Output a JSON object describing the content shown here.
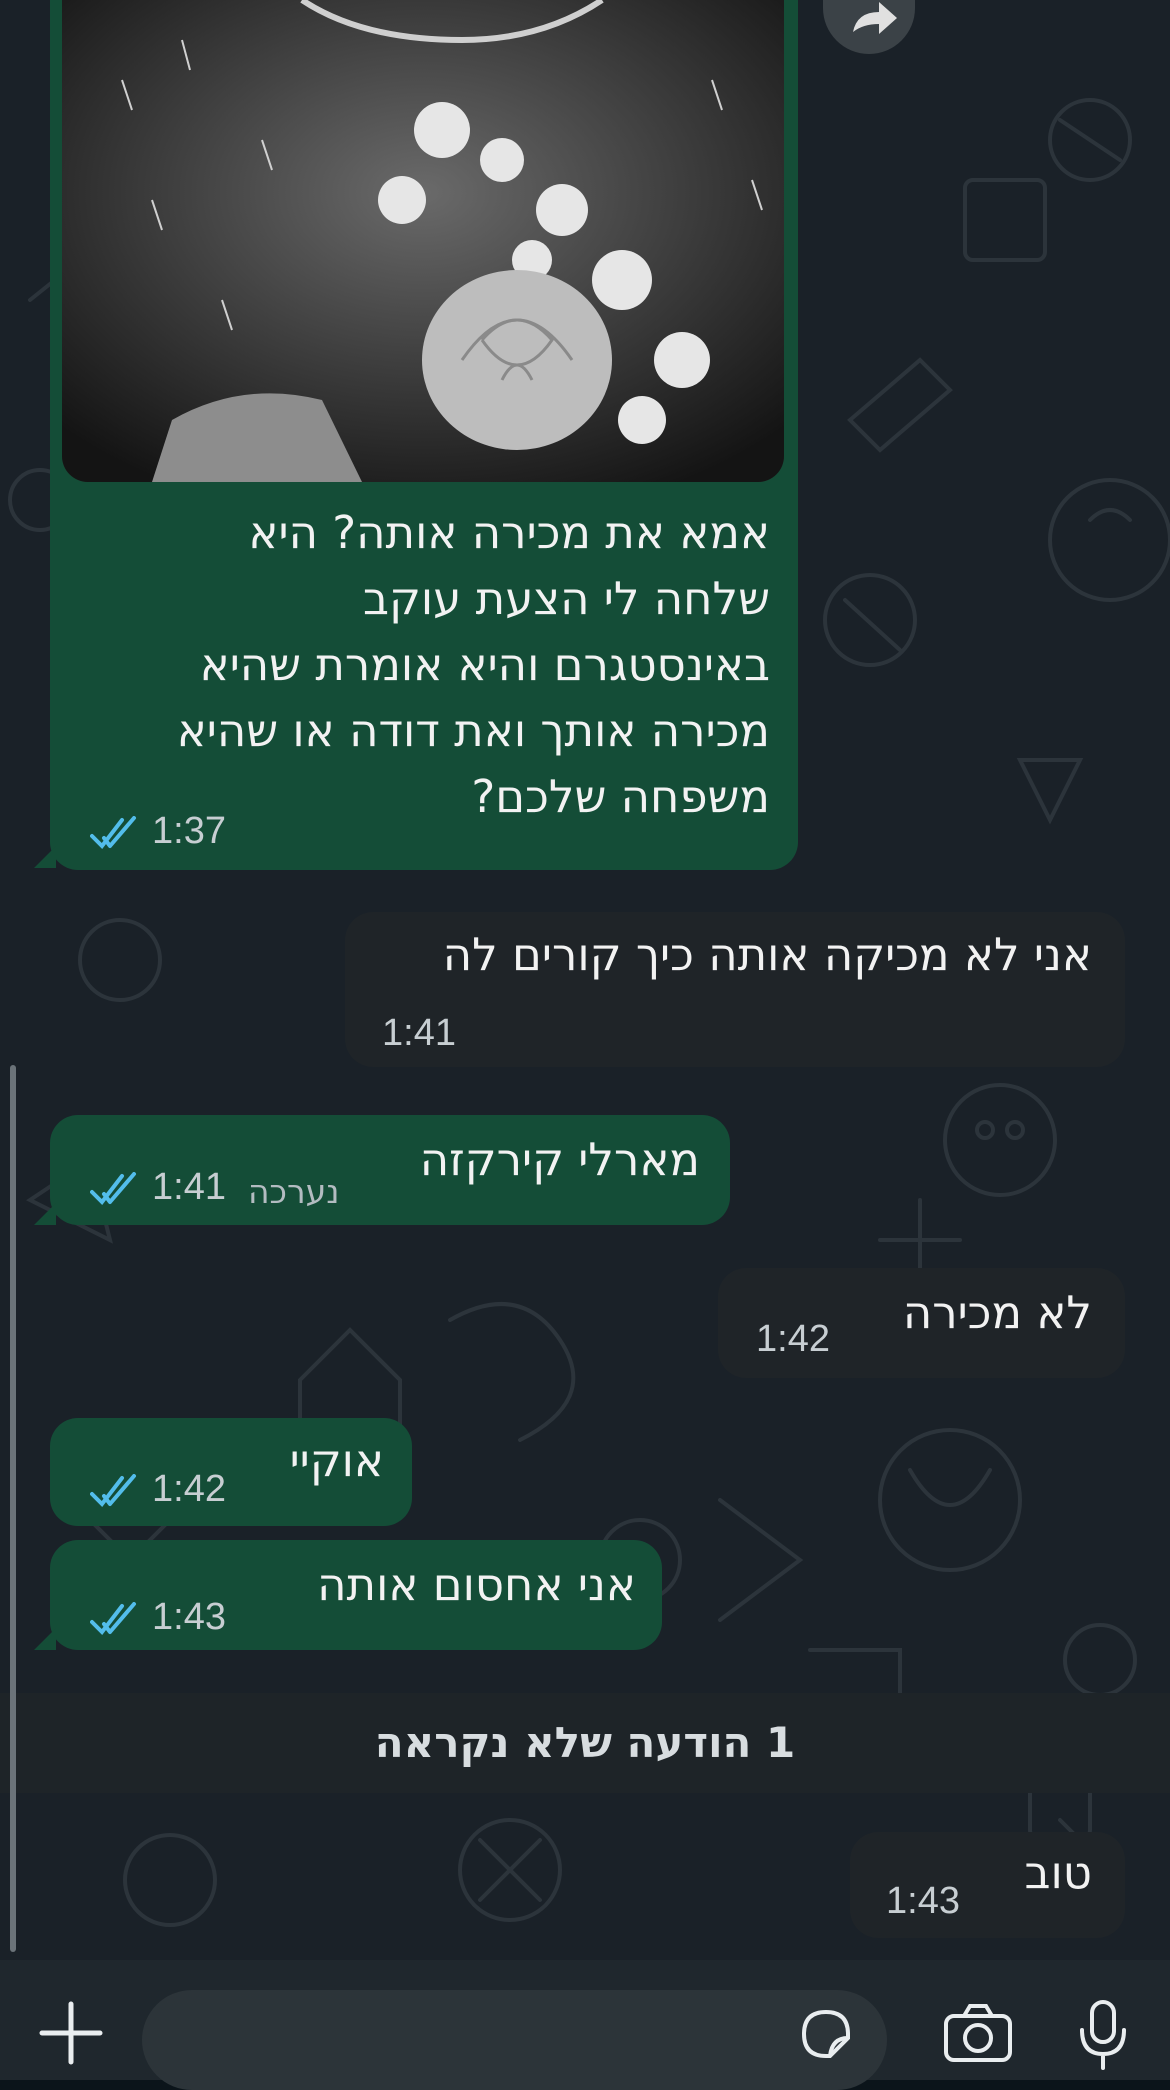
{
  "messages": [
    {
      "id": "m1",
      "direction": "out",
      "text": "אמא את מכירה אותה? היא\nשלחה לי הצעת עוקב\nבאינסטגרם והיא אומרת שהיא\nמכירה אותך ואת דודה או שהיא\nמשפחה שלכם?",
      "time": "1:37",
      "status": "read"
    },
    {
      "id": "m2",
      "direction": "in",
      "text": "אני לא מכיקה אותה כיך קורים לה",
      "time": "1:41"
    },
    {
      "id": "m3",
      "direction": "out",
      "text": "מארלי קירקזה",
      "time": "1:41",
      "edited": "נערכה",
      "status": "read"
    },
    {
      "id": "m4",
      "direction": "in",
      "text": "לא מכירה",
      "time": "1:42"
    },
    {
      "id": "m5",
      "direction": "out",
      "text": "אוקיי",
      "time": "1:42",
      "status": "read"
    },
    {
      "id": "m6",
      "direction": "out",
      "text": "אני אחסום אותה",
      "time": "1:43",
      "status": "read"
    },
    {
      "id": "m7",
      "direction": "in",
      "text": "טוב",
      "time": "1:43"
    }
  ],
  "unread_divider": "1 הודעה שלא נקראה",
  "input": {
    "placeholder": ""
  },
  "colors": {
    "outgoing": "#144d37",
    "incoming": "#1f2428",
    "read_ticks": "#53bdeb",
    "background": "#1a2128"
  },
  "icons": {
    "forward": "forward-icon",
    "attach": "plus-icon",
    "sticker": "sticker-icon",
    "camera": "camera-icon",
    "mic": "microphone-icon"
  }
}
